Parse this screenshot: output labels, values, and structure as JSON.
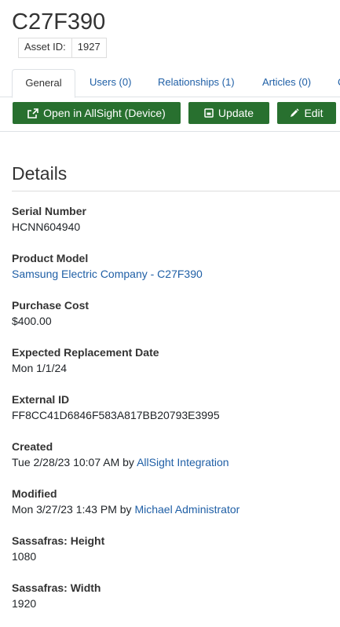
{
  "header": {
    "title": "C27F390"
  },
  "asset_id": {
    "label": "Asset ID:",
    "value": "1927"
  },
  "tabs": [
    {
      "label": "General"
    },
    {
      "label": "Users (0)"
    },
    {
      "label": "Relationships (1)"
    },
    {
      "label": "Articles (0)"
    },
    {
      "label": "C"
    }
  ],
  "toolbar": {
    "open_label": "Open in AllSight (Device)",
    "update_label": "Update",
    "edit_label": "Edit"
  },
  "details": {
    "title": "Details",
    "serial_number": {
      "label": "Serial Number",
      "value": "HCNN604940"
    },
    "product_model": {
      "label": "Product Model",
      "value": "Samsung Electric Company - C27F390"
    },
    "purchase_cost": {
      "label": "Purchase Cost",
      "value": "$400.00"
    },
    "expected_replacement": {
      "label": "Expected Replacement Date",
      "value": "Mon 1/1/24"
    },
    "external_id": {
      "label": "External ID",
      "value": "FF8CC41D6846F583A817BB20793E3995"
    },
    "created": {
      "label": "Created",
      "date": "Tue 2/28/23 10:07 AM",
      "by": "by",
      "user": "AllSight Integration"
    },
    "modified": {
      "label": "Modified",
      "date": "Mon 3/27/23 1:43 PM",
      "by": "by",
      "user": "Michael Administrator"
    },
    "height": {
      "label": "Sassafras: Height",
      "value": "1080"
    },
    "width": {
      "label": "Sassafras: Width",
      "value": "1920"
    }
  },
  "colors": {
    "accent_green": "#28702f",
    "link_blue": "#1f5fa6"
  },
  "icons": {
    "open": "external-link-icon",
    "update": "save-icon",
    "edit": "pencil-icon"
  }
}
